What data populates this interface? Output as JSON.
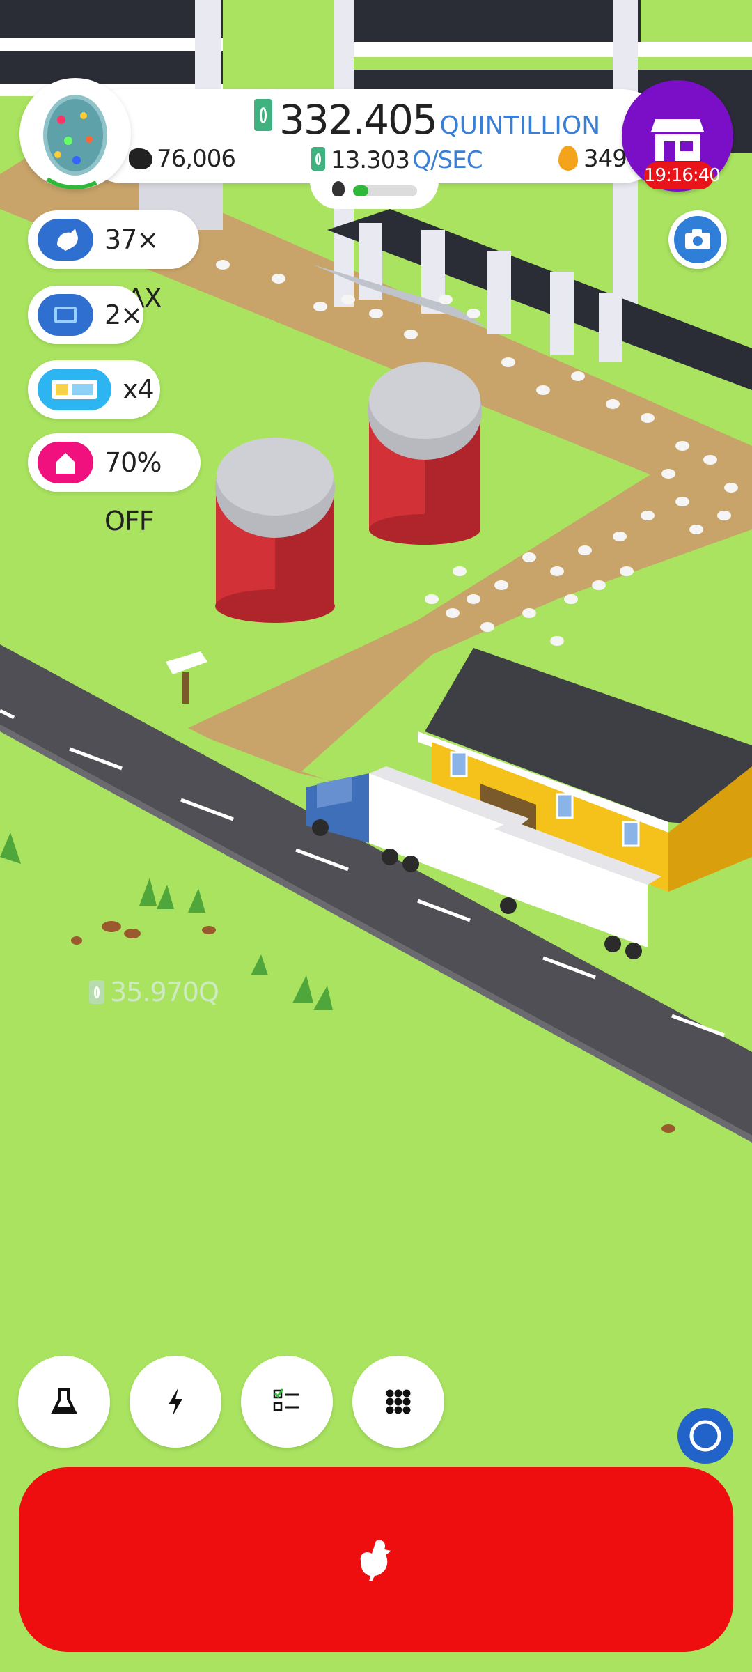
{
  "currency": {
    "main_value": "332.405",
    "main_unit": "QUINTILLION",
    "rate_value": "13.303",
    "rate_unit": "Q/SEC"
  },
  "stats": {
    "chickens": "76,006",
    "golden_eggs": "349"
  },
  "shop": {
    "timer": "19:16:40"
  },
  "boosts": [
    {
      "label": "37× MAX",
      "icon": "chicken-icon",
      "color": "#2f6fd0"
    },
    {
      "label": "2×",
      "icon": "tv-icon",
      "color": "#2f6fd0"
    },
    {
      "label": "x4",
      "icon": "boost-ticket-icon",
      "color": "#2cb5f0"
    },
    {
      "label": "70% OFF",
      "icon": "home-icon",
      "color": "#f0107e"
    }
  ],
  "floating_income": "35.970Q",
  "bottom_nav": [
    {
      "icon": "research-flask-icon"
    },
    {
      "icon": "lightning-icon"
    },
    {
      "icon": "checklist-icon"
    },
    {
      "icon": "menu-grid-icon"
    }
  ],
  "colors": {
    "grass": "#a9e35f",
    "hatch_button": "#ee0e0f",
    "shop_button": "#7b0fc8",
    "timer_badge": "#e8141a",
    "accent_blue": "#3a7fd6"
  }
}
